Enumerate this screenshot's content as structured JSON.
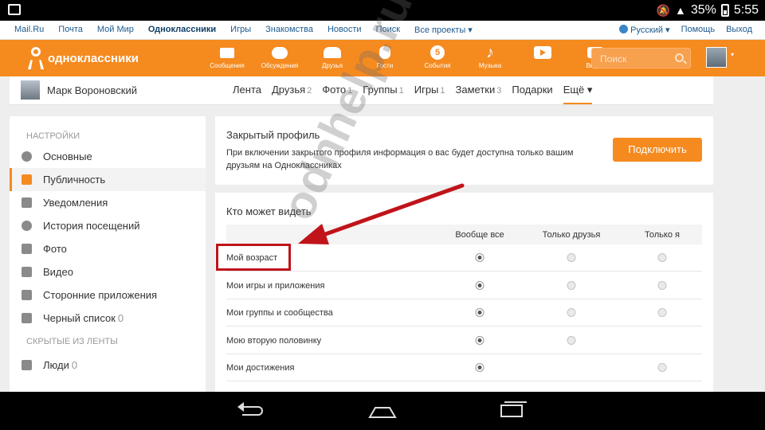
{
  "statusbar": {
    "battery": "35%",
    "time": "5:55"
  },
  "mailbar": {
    "links": [
      "Mail.Ru",
      "Почта",
      "Мой Мир",
      "Одноклассники",
      "Игры",
      "Знакомства",
      "Новости",
      "Поиск",
      "Все проекты ▾"
    ],
    "active_index": 3,
    "language": "Русский ▾",
    "help": "Помощь",
    "logout": "Выход"
  },
  "header": {
    "logo_text": "одноклассники",
    "nav": [
      {
        "label": "Сообщения",
        "icon": "envelope-icon"
      },
      {
        "label": "Обсуждения",
        "icon": "chat-icon"
      },
      {
        "label": "Друзья",
        "icon": "people-icon"
      },
      {
        "label": "Гости",
        "icon": "footprints-icon"
      },
      {
        "label": "События",
        "icon": "events-badge-icon",
        "badge": "5"
      },
      {
        "label": "Музыка",
        "icon": "music-note-icon"
      },
      {
        "label": "",
        "icon": "video-play-icon"
      },
      {
        "label": "Видео",
        "icon": "camera-icon"
      }
    ],
    "search_placeholder": "Поиск"
  },
  "profile": {
    "name": "Марк Вороновский",
    "tabs": [
      {
        "label": "Лента",
        "count": ""
      },
      {
        "label": "Друзья",
        "count": "2"
      },
      {
        "label": "Фото",
        "count": "1"
      },
      {
        "label": "Группы",
        "count": "1"
      },
      {
        "label": "Игры",
        "count": "1"
      },
      {
        "label": "Заметки",
        "count": "3"
      },
      {
        "label": "Подарки",
        "count": ""
      },
      {
        "label": "Ещё ▾",
        "count": ""
      }
    ]
  },
  "sidebar": {
    "section1": "Настройки",
    "items": [
      {
        "label": "Основные",
        "icon": "gear-icon",
        "count": ""
      },
      {
        "label": "Публичность",
        "icon": "megaphone-icon",
        "count": "",
        "active": true
      },
      {
        "label": "Уведомления",
        "icon": "notification-icon",
        "count": ""
      },
      {
        "label": "История посещений",
        "icon": "history-icon",
        "count": ""
      },
      {
        "label": "Фото",
        "icon": "camera-icon",
        "count": ""
      },
      {
        "label": "Видео",
        "icon": "film-icon",
        "count": ""
      },
      {
        "label": "Сторонние приложения",
        "icon": "app-window-icon",
        "count": ""
      },
      {
        "label": "Черный список",
        "icon": "blocked-user-icon",
        "count": "0"
      }
    ],
    "section2": "Скрытые из ленты",
    "items2": [
      {
        "label": "Люди",
        "icon": "people-icon",
        "count": "0"
      }
    ]
  },
  "closed_profile": {
    "title": "Закрытый профиль",
    "description": "При включении закрытого профиля информация о вас будет доступна только вашим друзьям на Одноклассниках",
    "button": "Подключить"
  },
  "visibility": {
    "title": "Кто может видеть",
    "columns": [
      "Вообще все",
      "Только друзья",
      "Только я"
    ],
    "rows": [
      {
        "label": "Мой возраст",
        "options": [
          true,
          false,
          false
        ],
        "has": [
          true,
          true,
          true
        ]
      },
      {
        "label": "Мои игры и приложения",
        "options": [
          true,
          false,
          false
        ],
        "has": [
          true,
          true,
          true
        ]
      },
      {
        "label": "Мои группы и сообщества",
        "options": [
          true,
          false,
          false
        ],
        "has": [
          true,
          true,
          true
        ]
      },
      {
        "label": "Мою вторую половинку",
        "options": [
          true,
          false,
          false
        ],
        "has": [
          true,
          true,
          false
        ]
      },
      {
        "label": "Мои достижения",
        "options": [
          true,
          false,
          false
        ],
        "has": [
          true,
          false,
          true
        ]
      }
    ]
  },
  "watermark": "odnhelp.ru",
  "colors": {
    "brand_orange": "#f58a1f",
    "annotation_red": "#c0141a"
  }
}
